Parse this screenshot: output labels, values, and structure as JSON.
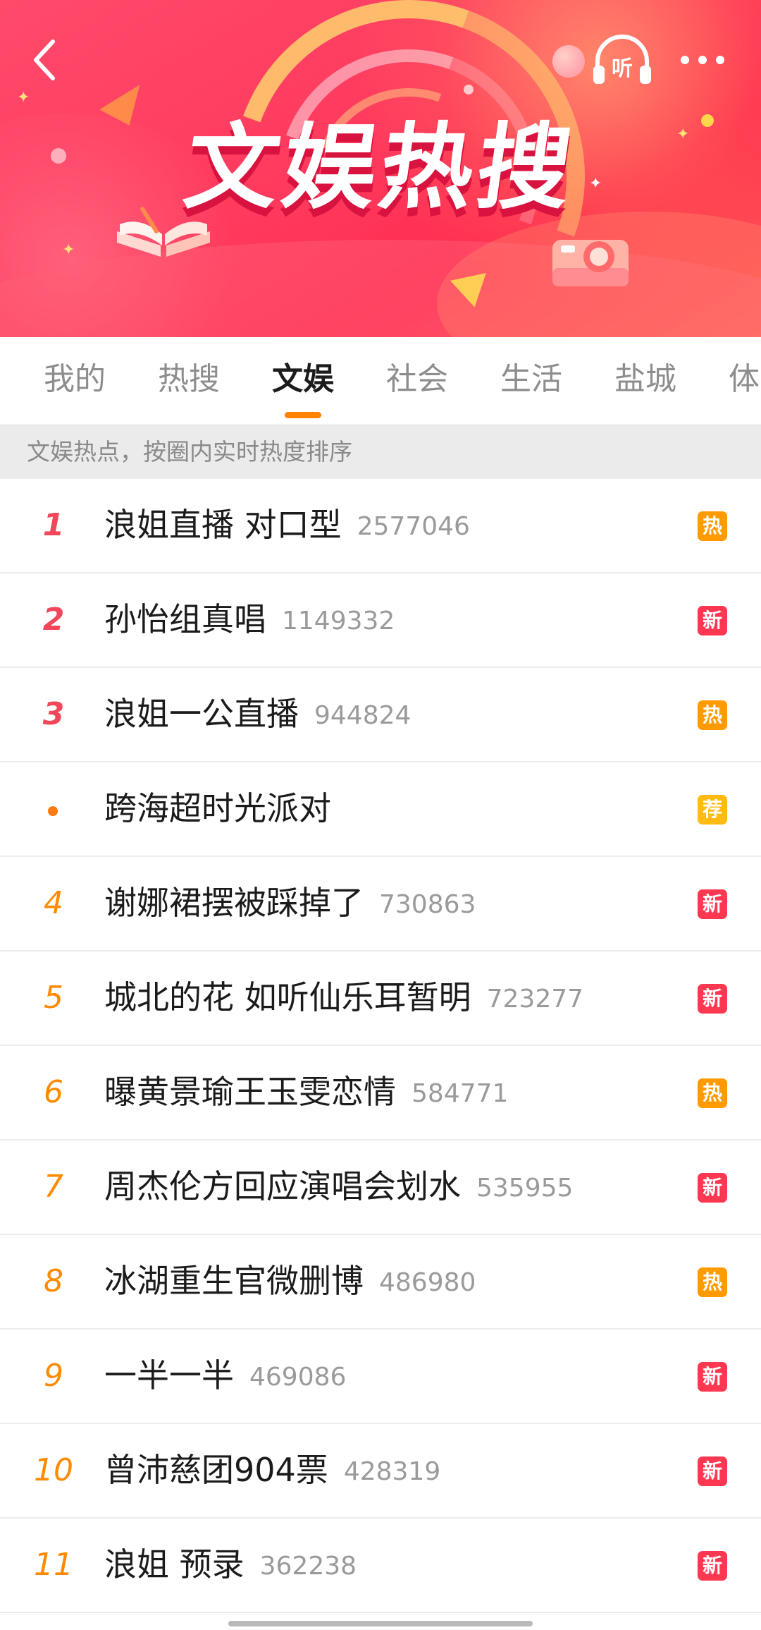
{
  "banner": {
    "title_chars": [
      "文",
      "娱",
      "热",
      "搜"
    ],
    "listen_label": "听",
    "colors": {
      "background": "#ff3a5e",
      "title": "#ffffff",
      "title_shadow": "#d8133f"
    }
  },
  "tabs": [
    {
      "label": "我的",
      "active": false
    },
    {
      "label": "热搜",
      "active": false
    },
    {
      "label": "文娱",
      "active": true
    },
    {
      "label": "社会",
      "active": false
    },
    {
      "label": "生活",
      "active": false
    },
    {
      "label": "盐城",
      "active": false
    },
    {
      "label": "体",
      "active": false
    }
  ],
  "hint": "文娱热点，按圈内实时热度排序",
  "items": [
    {
      "rank": "1",
      "title": "浪姐直播 对口型",
      "count": "2577046",
      "badge": "热"
    },
    {
      "rank": "2",
      "title": "孙怡组真唱",
      "count": "1149332",
      "badge": "新"
    },
    {
      "rank": "3",
      "title": "浪姐一公直播",
      "count": "944824",
      "badge": "热"
    },
    {
      "rank": "",
      "title": "跨海超时光派对",
      "count": "",
      "badge": "荐"
    },
    {
      "rank": "4",
      "title": "谢娜裙摆被踩掉了",
      "count": "730863",
      "badge": "新"
    },
    {
      "rank": "5",
      "title": "城北的花 如听仙乐耳暂明",
      "count": "723277",
      "badge": "新"
    },
    {
      "rank": "6",
      "title": "曝黄景瑜王玉雯恋情",
      "count": "584771",
      "badge": "热"
    },
    {
      "rank": "7",
      "title": "周杰伦方回应演唱会划水",
      "count": "535955",
      "badge": "新"
    },
    {
      "rank": "8",
      "title": "冰湖重生官微删博",
      "count": "486980",
      "badge": "热"
    },
    {
      "rank": "9",
      "title": "一半一半",
      "count": "469086",
      "badge": "新"
    },
    {
      "rank": "10",
      "title": "曾沛慈团904票",
      "count": "428319",
      "badge": "新"
    },
    {
      "rank": "11",
      "title": "浪姐 预录",
      "count": "362238",
      "badge": "新"
    }
  ],
  "badge_colors": {
    "热": "#ff9a00",
    "新": "#ff3852",
    "荐": "#ffbb10"
  },
  "rank_colors": {
    "top": "#f0485a",
    "other": "#ff8a00",
    "promoted_dot": "#ff7a10"
  },
  "accent": "#ff8200"
}
